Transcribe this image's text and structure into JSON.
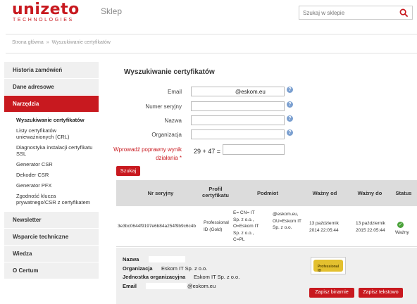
{
  "header": {
    "brand": "unizeto",
    "brand_sub": "TECHNOLOGIES",
    "shop_label": "Sklep",
    "search_placeholder": "Szukaj w sklepie"
  },
  "breadcrumb": {
    "home": "Strona główna",
    "separator": "»",
    "current": "Wyszukiwanie certyfikatów"
  },
  "sidebar": {
    "items": [
      {
        "label": "Historia zamówień"
      },
      {
        "label": "Dane adresowe"
      },
      {
        "label": "Narzędzia",
        "active": true
      },
      {
        "label": "Newsletter"
      },
      {
        "label": "Wsparcie techniczne"
      },
      {
        "label": "Wiedza"
      },
      {
        "label": "O Certum"
      }
    ],
    "tools_submenu": [
      {
        "label": "Wyszukiwanie certyfikatów",
        "current": true
      },
      {
        "label": "Listy certyfikatów unieważnionych (CRL)"
      },
      {
        "label": "Diagnostyka instalacji certyfikatu SSL"
      },
      {
        "label": "Generator CSR"
      },
      {
        "label": "Dekoder CSR"
      },
      {
        "label": "Generator PFX"
      },
      {
        "label": "Zgodność klucza prywatnego/CSR z certyfikatem"
      }
    ]
  },
  "form": {
    "title": "Wyszukiwanie certyfikatów",
    "email_label": "Email",
    "email_value": "@eskom.eu",
    "serial_label": "Numer seryjny",
    "name_label": "Nazwa",
    "org_label": "Organizacja",
    "captcha_label": "Wprowadź poprawny wynik działania *",
    "captcha_question": "29 + 47 =",
    "submit_label": "Szukaj",
    "help_glyph": "?"
  },
  "results": {
    "headers": {
      "serial": "Nr seryjny",
      "profile": "Profil certyfikatu",
      "subject": "Podmiot",
      "valid_from": "Ważny od",
      "valid_to": "Ważny do",
      "status": "Status"
    },
    "row": {
      "serial": "3e3bc0644f9197e6b84a254f9b9c6c4b",
      "profile": "Professional ID (Gold)",
      "subject_left": "E= CN= IT Sp. z o.o., O=Eskom IT Sp. z o.o., C=PL",
      "subject_right": "@eskom.eu, OU=Eskom IT Sp. z o.o.",
      "valid_from": "13 październik 2014 22:05:44",
      "valid_to": "13 październik 2015 22:05:44",
      "status": "Ważny"
    },
    "details": {
      "name_label": "Nazwa",
      "org_label": "Organizacja",
      "org_value": "Eskom IT Sp. z o.o.",
      "unit_label": "Jednostka organizacyjna",
      "unit_value": "Eskom IT Sp. z o.o.",
      "email_label": "Email",
      "email_value": "@eskom.eu",
      "badge_text": "Professional ID",
      "save_binary": "Zapisz binarnie",
      "save_text": "Zapisz tekstowo"
    }
  },
  "colors": {
    "brand_red": "#c8191f",
    "sidebar_bg": "#f0f0f0",
    "table_header_bg": "#dcdcdc",
    "details_bg": "#efefef",
    "status_green": "#4aa23a",
    "help_blue": "#7a9fd0"
  }
}
